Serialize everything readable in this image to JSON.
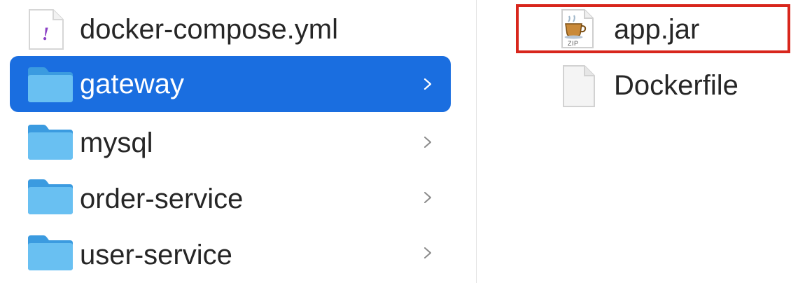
{
  "left_column": {
    "items": [
      {
        "label": "docker-compose.yml",
        "icon": "yaml-file-icon",
        "type": "file",
        "selected": false
      },
      {
        "label": "gateway",
        "icon": "folder-icon",
        "type": "folder",
        "selected": true
      },
      {
        "label": "mysql",
        "icon": "folder-icon",
        "type": "folder",
        "selected": false
      },
      {
        "label": "order-service",
        "icon": "folder-icon",
        "type": "folder",
        "selected": false
      },
      {
        "label": "user-service",
        "icon": "folder-icon",
        "type": "folder",
        "selected": false
      }
    ]
  },
  "right_column": {
    "items": [
      {
        "label": "app.jar",
        "icon": "jar-archive-icon",
        "zip_badge": "ZIP",
        "highlighted": true
      },
      {
        "label": "Dockerfile",
        "icon": "generic-document-icon",
        "highlighted": false
      }
    ]
  },
  "colors": {
    "selection": "#1a6ee0",
    "folder": "#4aaee8",
    "highlight_border": "#d8261c",
    "yaml_mark": "#8a3fc4"
  }
}
